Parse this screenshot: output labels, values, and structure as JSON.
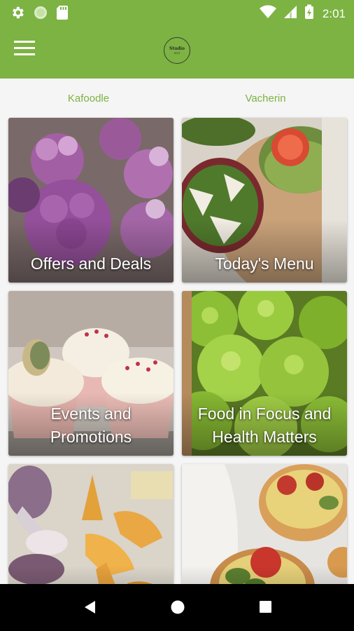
{
  "status_bar": {
    "time": "2:01",
    "icons": [
      "settings-icon",
      "circle-icon",
      "sd-card-icon",
      "wifi-icon",
      "signal-icon",
      "battery-charging-icon"
    ]
  },
  "app_bar": {
    "logo_text": "Studio",
    "logo_sub": "KCH",
    "menu_icon": "hamburger-menu-icon",
    "color": "#7cb342"
  },
  "venues": [
    {
      "label": "Kafoodle"
    },
    {
      "label": "Vacherin"
    }
  ],
  "tiles": [
    {
      "label": "Offers and Deals"
    },
    {
      "label": "Today's Menu"
    },
    {
      "label": "Events and Promotions"
    },
    {
      "label": "Food in Focus and Health Matters"
    },
    {
      "label": ""
    },
    {
      "label": ""
    }
  ],
  "nav_bar": {
    "icons": [
      "back-icon",
      "home-icon",
      "recents-icon"
    ]
  },
  "colors": {
    "accent": "#7cb342",
    "nav": "#000000"
  }
}
